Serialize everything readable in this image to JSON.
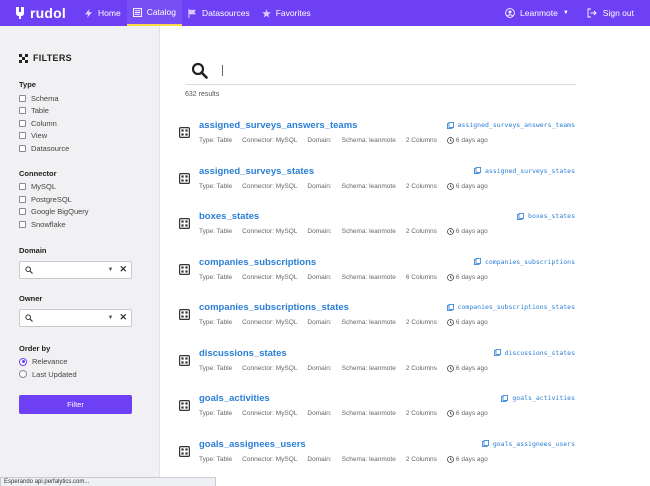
{
  "brand": {
    "name": "rudol"
  },
  "nav": {
    "items": [
      {
        "label": "Home",
        "icon": "bolt-icon",
        "active": false
      },
      {
        "label": "Catalog",
        "icon": "catalog-icon",
        "active": true
      },
      {
        "label": "Datasources",
        "icon": "flag-icon",
        "active": false
      },
      {
        "label": "Favorites",
        "icon": "star-icon",
        "active": false
      }
    ],
    "user": "Leanmote",
    "signout": "Sign out"
  },
  "sidebar": {
    "title": "FILTERS",
    "type": {
      "title": "Type",
      "options": [
        "Schema",
        "Table",
        "Column",
        "View",
        "Datasource"
      ]
    },
    "connector": {
      "title": "Connector",
      "options": [
        "MySQL",
        "PostgreSQL",
        "Google BigQuery",
        "Snowflake"
      ]
    },
    "domain": {
      "title": "Domain"
    },
    "owner": {
      "title": "Owner"
    },
    "order_by": {
      "title": "Order by",
      "options": [
        "Relevance",
        "Last Updated"
      ],
      "selected": "Relevance"
    },
    "filter_button": "Filter"
  },
  "search": {
    "value": ""
  },
  "results": {
    "count_label": "632 results",
    "items": [
      {
        "title": "assigned_surveys_answers_teams",
        "copy": "assigned_surveys_answers_teams",
        "type": "Type: Table",
        "connector": "Connector: MySQL",
        "domain": "Domain:",
        "schema": "Schema: leanmote",
        "columns": "2 Columns",
        "updated": "6 days ago"
      },
      {
        "title": "assigned_surveys_states",
        "copy": "assigned_surveys_states",
        "type": "Type: Table",
        "connector": "Connector: MySQL",
        "domain": "Domain:",
        "schema": "Schema: leanmote",
        "columns": "2 Columns",
        "updated": "6 days ago"
      },
      {
        "title": "boxes_states",
        "copy": "boxes_states",
        "type": "Type: Table",
        "connector": "Connector: MySQL",
        "domain": "Domain:",
        "schema": "Schema: leanmote",
        "columns": "2 Columns",
        "updated": "6 days ago"
      },
      {
        "title": "companies_subscriptions",
        "copy": "companies_subscriptions",
        "type": "Type: Table",
        "connector": "Connector: MySQL",
        "domain": "Domain:",
        "schema": "Schema: leanmote",
        "columns": "6 Columns",
        "updated": "6 days ago"
      },
      {
        "title": "companies_subscriptions_states",
        "copy": "companies_subscriptions_states",
        "type": "Type: Table",
        "connector": "Connector: MySQL",
        "domain": "Domain:",
        "schema": "Schema: leanmote",
        "columns": "2 Columns",
        "updated": "6 days ago"
      },
      {
        "title": "discussions_states",
        "copy": "discussions_states",
        "type": "Type: Table",
        "connector": "Connector: MySQL",
        "domain": "Domain:",
        "schema": "Schema: leanmote",
        "columns": "2 Columns",
        "updated": "6 days ago"
      },
      {
        "title": "goals_activities",
        "copy": "goals_activities",
        "type": "Type: Table",
        "connector": "Connector: MySQL",
        "domain": "Domain:",
        "schema": "Schema: leanmote",
        "columns": "2 Columns",
        "updated": "6 days ago"
      },
      {
        "title": "goals_assignees_users",
        "copy": "goals_assignees_users",
        "type": "Type: Table",
        "connector": "Connector: MySQL",
        "domain": "Domain:",
        "schema": "Schema: leanmote",
        "columns": "2 Columns",
        "updated": "6 days ago"
      }
    ]
  },
  "status": {
    "text": "Esperando api.perfalytics.com..."
  },
  "colors": {
    "accent": "#6d3ff5",
    "link": "#2b7fd6",
    "active_tab_indicator": "#ffd84a"
  }
}
